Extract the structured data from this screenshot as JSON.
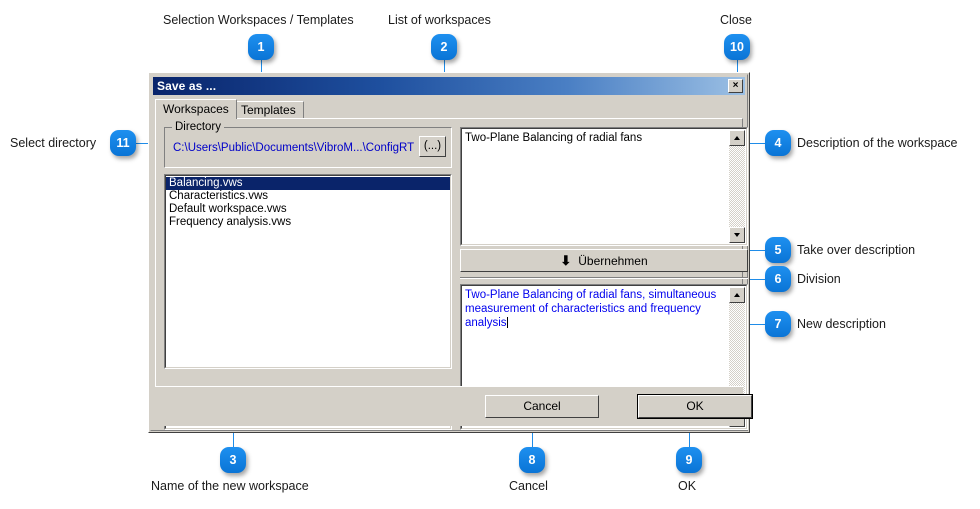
{
  "dialog": {
    "title": "Save as ...",
    "close_label": "×",
    "tabs": [
      {
        "label": "Workspaces",
        "active": true
      },
      {
        "label": "Templates",
        "active": false
      }
    ],
    "directory": {
      "group_label": "Directory",
      "path": "C:\\Users\\Public\\Documents\\VibroM...\\ConfigRT",
      "browse_label": "(...)"
    },
    "workspace_list": [
      {
        "label": "Balancing.vws",
        "selected": true
      },
      {
        "label": "Characteristics.vws",
        "selected": false
      },
      {
        "label": "Default workspace.vws",
        "selected": false
      },
      {
        "label": "Frequency analysis.vws",
        "selected": false
      }
    ],
    "filename_value": "Balancing.vws",
    "description_value": "Two-Plane Balancing of radial fans",
    "take_over_label": "Übernehmen",
    "take_over_icon": "down-arrow-icon",
    "new_description_value": "Two-Plane Balancing of radial fans, simultaneous measurement of characteristics and frequency analysis",
    "buttons": {
      "cancel": "Cancel",
      "ok": "OK"
    }
  },
  "annotations": [
    {
      "n": "1",
      "text": "Selection Workspaces / Templates"
    },
    {
      "n": "2",
      "text": "List of workspaces"
    },
    {
      "n": "3",
      "text": "Name of the new workspace"
    },
    {
      "n": "4",
      "text": "Description of the workspace"
    },
    {
      "n": "5",
      "text": "Take over description"
    },
    {
      "n": "6",
      "text": "Division"
    },
    {
      "n": "7",
      "text": "New description"
    },
    {
      "n": "8",
      "text": "Cancel"
    },
    {
      "n": "9",
      "text": "OK"
    },
    {
      "n": "10",
      "text": "Close"
    },
    {
      "n": "11",
      "text": "Select directory"
    }
  ],
  "colors": {
    "marker_blue": "#0b7fe0",
    "line_blue": "#1f8ce8",
    "dialog_face": "#d4d0c8",
    "selection_blue": "#0a246a",
    "path_text": "#0000c8",
    "new_desc_text": "#0000ee"
  }
}
